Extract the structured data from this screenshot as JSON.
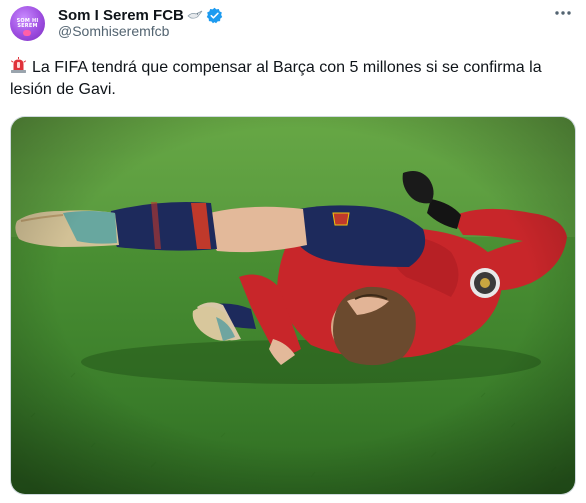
{
  "author": {
    "display_name": "Som I Serem FCB",
    "handle": "@Somhiseremfcb",
    "verified": true,
    "avatar_text": "SOM HI SEREM",
    "avatar_icon": "avatar-logo-icon",
    "name_emoji": "bird-emoji-icon"
  },
  "tweet": {
    "emoji": "police-light-emoji",
    "text": "La FIFA tendrá que compensar al Barça con 5 millones si se confirma la lesión de Gavi."
  },
  "actions": {
    "more_icon": "more-options-icon"
  },
  "colors": {
    "verified_blue": "#1d9bf0",
    "pitch_green": "#3e8a2e",
    "spain_red": "#d42a2a",
    "spain_navy": "#1d2a5c",
    "handle_gray": "#536471"
  }
}
